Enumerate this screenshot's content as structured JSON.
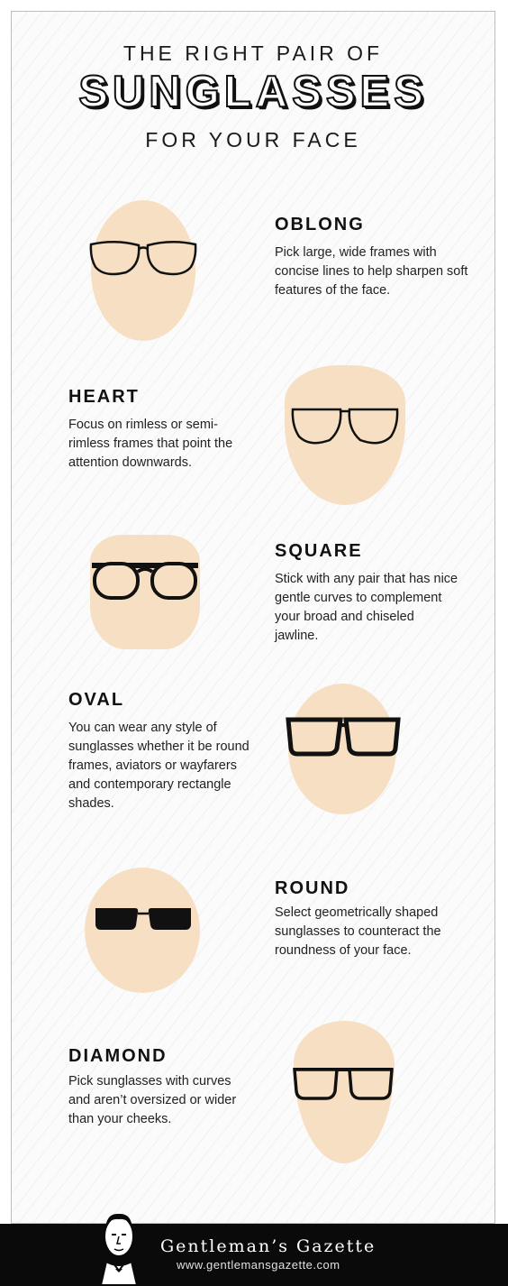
{
  "header": {
    "line1": "THE RIGHT PAIR OF",
    "line2": "SUNGLASSES",
    "line3": "FOR YOUR FACE"
  },
  "face_shapes": [
    {
      "name": "OBLONG",
      "description": "Pick large, wide frames with concise lines to help sharpen soft features of the face."
    },
    {
      "name": "HEART",
      "description": "Focus on rimless or semi-rimless frames that point the attention downwards."
    },
    {
      "name": "SQUARE",
      "description": "Stick with any pair that has nice gentle curves to complement your broad and chiseled jawline."
    },
    {
      "name": "OVAL",
      "description": "You can wear any style of sunglasses whether it be round frames, aviators or wayfarers and contemporary rectangle shades."
    },
    {
      "name": "ROUND",
      "description": "Select geometrically shaped sunglasses to counteract the roundness of your face."
    },
    {
      "name": "DIAMOND",
      "description": "Pick sunglasses with curves and aren’t oversized or wider than your cheeks."
    }
  ],
  "footer": {
    "brand": "Gentleman’s Gazette",
    "website": "www.gentlemansgazette.com"
  },
  "colors": {
    "skin": "#f6dfc2",
    "frame": "#111111",
    "footer_bg": "#0a0a0a"
  }
}
